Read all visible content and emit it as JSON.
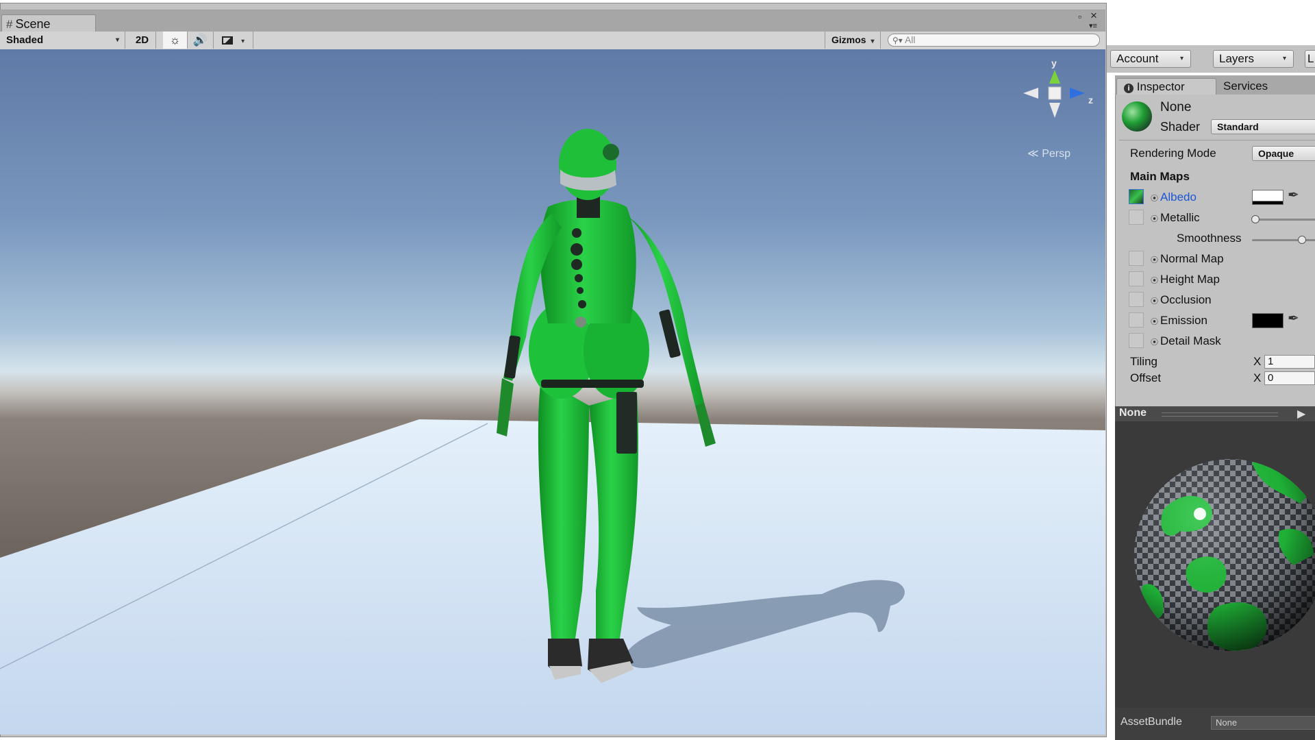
{
  "scene": {
    "tab_label": "Scene",
    "shading_mode": "Shaded",
    "btn_2d": "2D",
    "gizmos_label": "Gizmos",
    "search_placeholder": "All",
    "axis_y": "y",
    "axis_z": "z",
    "projection": "Persp"
  },
  "toolbar": {
    "account": "Account",
    "layers": "Layers",
    "layout_initial": "L"
  },
  "inspector": {
    "tab_inspector": "Inspector",
    "tab_services": "Services",
    "material_name": "None",
    "shader_label": "Shader",
    "shader_value": "Standard",
    "rendering_mode_label": "Rendering Mode",
    "rendering_mode_value": "Opaque",
    "main_maps_header": "Main Maps",
    "albedo": "Albedo",
    "metallic": "Metallic",
    "smoothness": "Smoothness",
    "normal_map": "Normal Map",
    "height_map": "Height Map",
    "occlusion": "Occlusion",
    "emission": "Emission",
    "detail_mask": "Detail Mask",
    "tiling_label": "Tiling",
    "offset_label": "Offset",
    "tiling_x_axis": "X",
    "tiling_x_value": "1",
    "offset_x_axis": "X",
    "offset_x_value": "0",
    "metallic_level": 0.0,
    "smoothness_level": 0.5
  },
  "preview": {
    "name": "None"
  },
  "asset_bundle": {
    "label": "AssetBundle",
    "value": "None"
  },
  "colors": {
    "suit_green": "#1fbf3a",
    "albedo_color": "#ffffff",
    "emission_color": "#000000",
    "label_blue": "#1f55d6"
  }
}
